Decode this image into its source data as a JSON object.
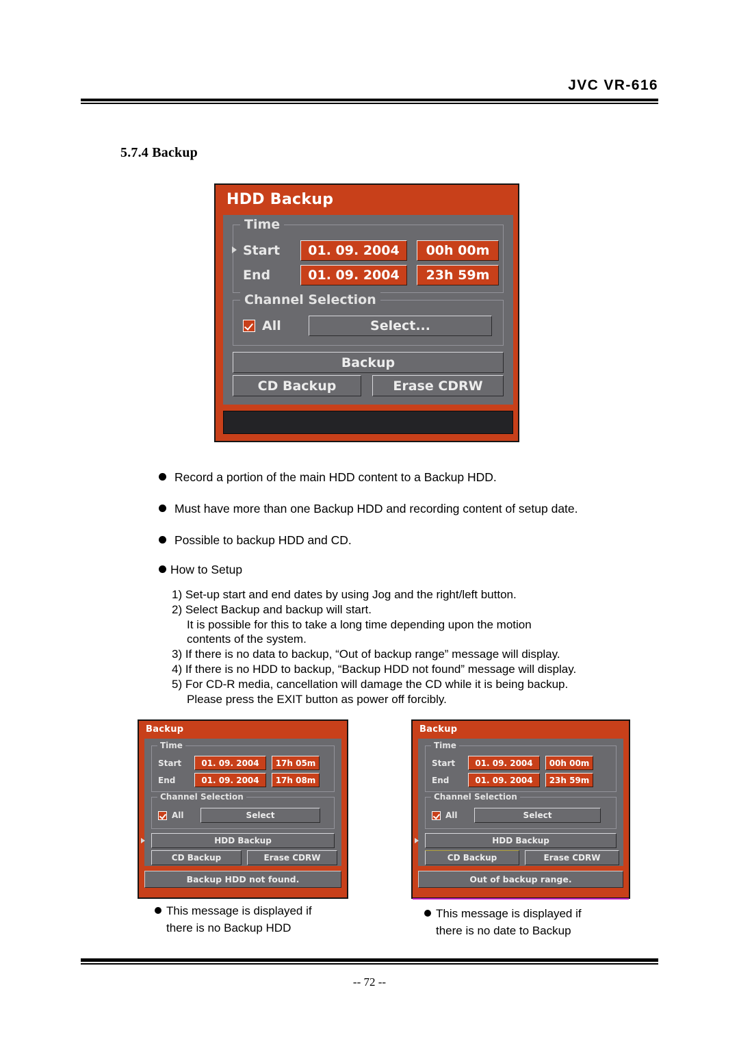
{
  "header": {
    "title": "JVC VR-616"
  },
  "section": {
    "heading": "5.7.4 Backup"
  },
  "main_dialog": {
    "title": "HDD Backup",
    "time_legend": "Time",
    "start_label": "Start",
    "end_label": "End",
    "start_date": "01. 09. 2004",
    "start_time": "00h 00m",
    "end_date": "01. 09. 2004",
    "end_time": "23h 59m",
    "channel_legend": "Channel Selection",
    "all_label": "All",
    "select_label": "Select...",
    "backup_label": "Backup",
    "cd_backup_label": "CD Backup",
    "erase_cdrw_label": "Erase CDRW",
    "status_message": ""
  },
  "bullets": [
    "Record a portion of the main HDD content to a Backup HDD.",
    "Must have more than one Backup HDD and recording content of setup date.",
    "Possible to backup HDD and CD."
  ],
  "howto": {
    "label": "How to Setup"
  },
  "steps": [
    {
      "text": "1) Set-up start and end dates by using Jog and the right/left button.",
      "sub": []
    },
    {
      "text": "2) Select Backup and backup will start.",
      "sub": [
        "It is possible for this to take a long time depending upon the motion",
        "contents of the system."
      ]
    },
    {
      "text": "3) If there is no data to backup, “Out of backup range” message will display.",
      "sub": []
    },
    {
      "text": "4) If there is no HDD to backup, “Backup HDD not found” message will display.",
      "sub": []
    },
    {
      "text": "5) For CD-R media, cancellation will damage the CD while it is being backup.",
      "sub": [
        "Please press the EXIT button as power off forcibly."
      ]
    }
  ],
  "left_dialog": {
    "title": "Backup",
    "time_legend": "Time",
    "start_label": "Start",
    "end_label": "End",
    "start_date": "01. 09. 2004",
    "start_time": "17h 05m",
    "end_date": "01. 09. 2004",
    "end_time": "17h 08m",
    "channel_legend": "Channel Selection",
    "all_label": "All",
    "select_label": "Select",
    "hdd_backup_label": "HDD Backup",
    "cd_backup_label": "CD Backup",
    "erase_cdrw_label": "Erase CDRW",
    "status_message": "Backup HDD not found."
  },
  "right_dialog": {
    "title": "Backup",
    "time_legend": "Time",
    "start_label": "Start",
    "end_label": "End",
    "start_date": "01. 09. 2004",
    "start_time": "00h 00m",
    "end_date": "01. 09. 2004",
    "end_time": "23h 59m",
    "channel_legend": "Channel Selection",
    "all_label": "All",
    "select_label": "Select",
    "hdd_backup_label": "HDD Backup",
    "cd_backup_label": "CD Backup",
    "erase_cdrw_label": "Erase CDRW",
    "status_message": "Out of backup range."
  },
  "captions": {
    "left_line1": "This message is displayed if",
    "left_line2": "there is no Backup HDD",
    "right_line1": "This message is displayed if",
    "right_line2": "there is no date to Backup"
  },
  "footer": {
    "page_number": "-- 72 --"
  },
  "colors": {
    "osd_red": "#c8401a",
    "osd_gray": "#6a6a6e",
    "osd_border": "#151515",
    "status_dark": "#232326"
  }
}
